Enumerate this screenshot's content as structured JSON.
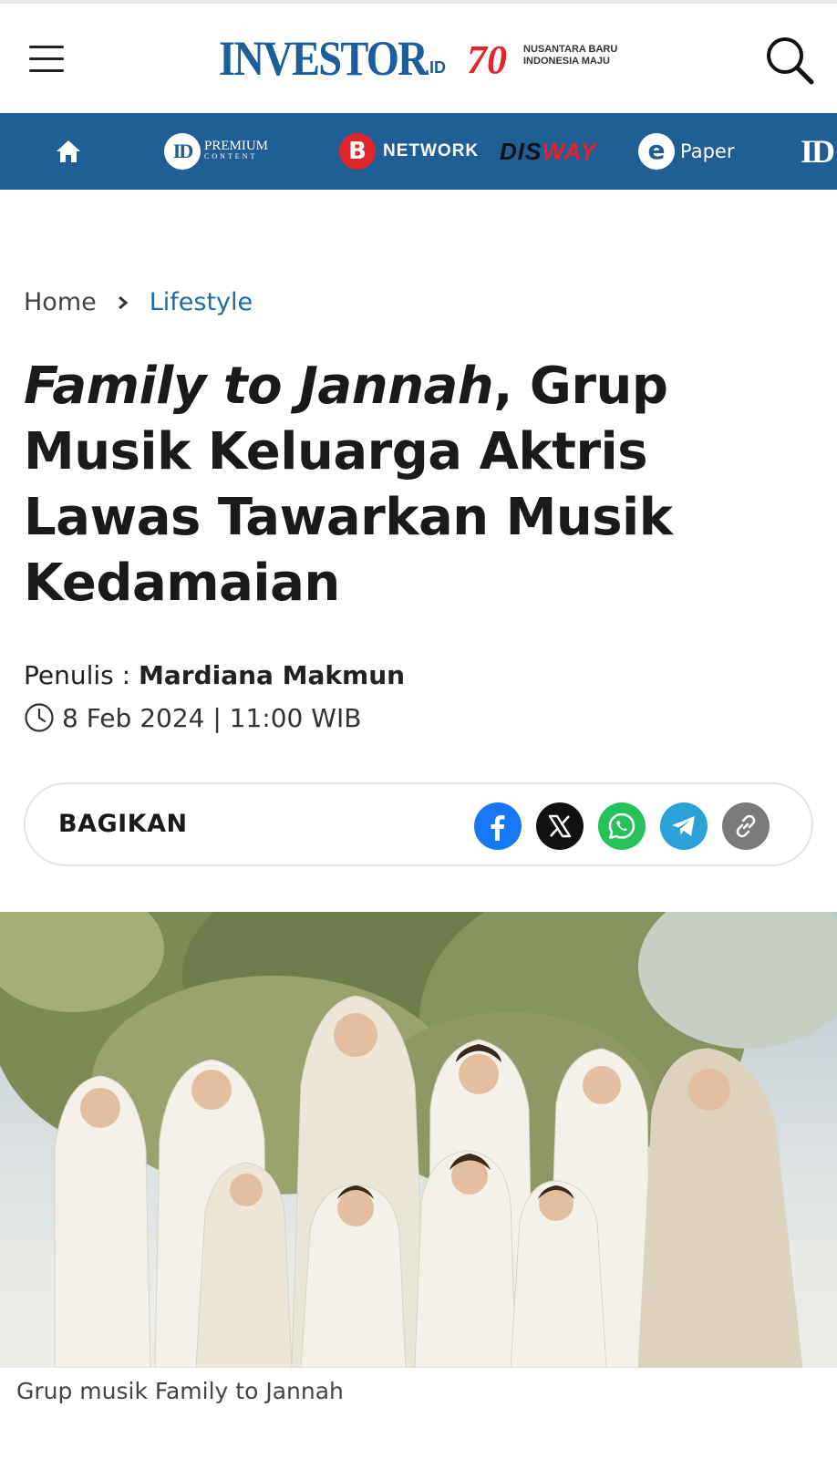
{
  "header": {
    "logo_text": "INVESTOR",
    "logo_suffix": ".ID",
    "anniversary_tagline_1": "NUSANTARA BARU",
    "anniversary_tagline_2": "INDONESIA MAJU",
    "anniversary_number": "70"
  },
  "nav": {
    "premium_badge": "ID",
    "premium_line1": "PREMIUM",
    "premium_line2": "CONTENT",
    "network_badge": "B",
    "network_label": "NETWORK",
    "disway_part1": "DIS",
    "disway_part2": "WAY",
    "epaper_badge": "e",
    "epaper_label": "Paper",
    "extra_label": "ID"
  },
  "breadcrumb": {
    "home": "Home",
    "category": "Lifestyle"
  },
  "article": {
    "title_italic": "Family to Jannah",
    "title_rest": ", Grup Musik Keluarga Aktris Lawas Tawarkan Musik Kedamaian",
    "author_label": "Penulis : ",
    "author_name": "Mardiana Makmun",
    "date": "8 Feb 2024 | 11:00 WIB",
    "caption": "Grup musik Family to Jannah"
  },
  "share": {
    "label": "BAGIKAN",
    "buttons": [
      "facebook-icon",
      "x-icon",
      "whatsapp-icon",
      "telegram-icon",
      "link-icon"
    ]
  },
  "colors": {
    "brand_blue": "#1f5f95",
    "link_blue": "#1f6aa6",
    "accent_red": "#e0252b"
  }
}
